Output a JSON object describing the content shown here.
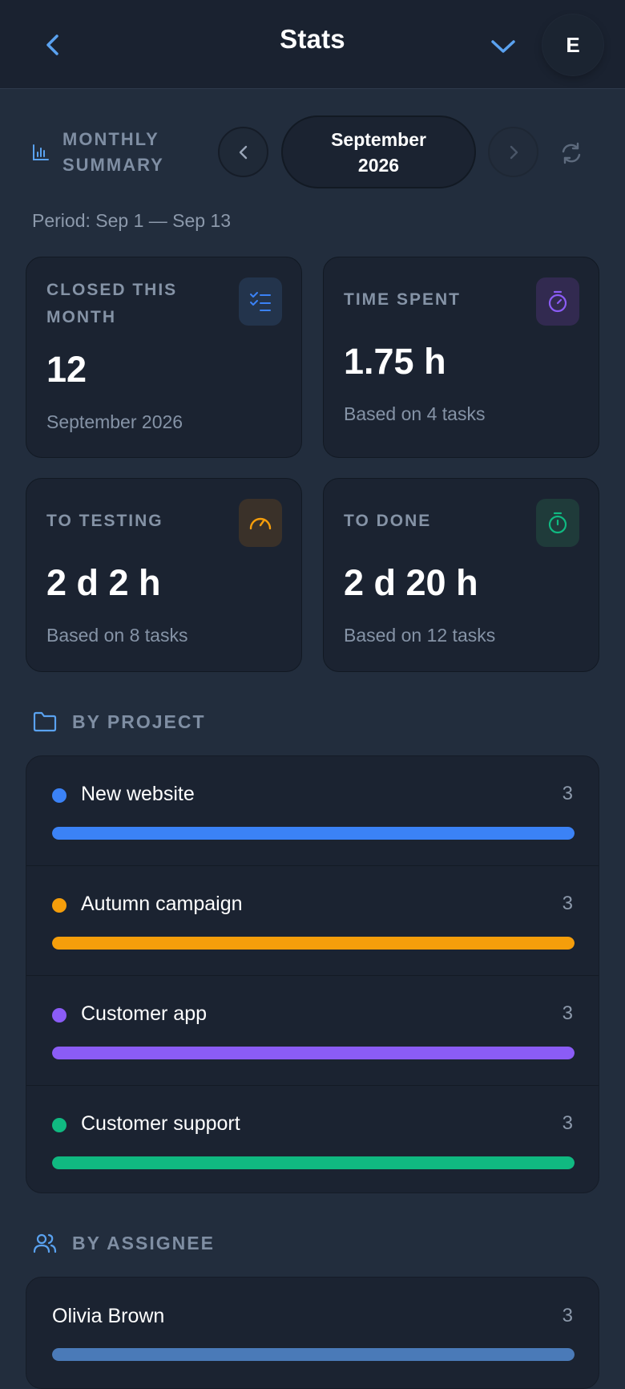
{
  "header": {
    "title": "Stats",
    "avatar_letter": "E",
    "back_icon": "chevron-left-icon",
    "dropdown_icon": "chevron-down-icon"
  },
  "summary": {
    "label": "MONTHLY SUMMARY",
    "month_line1": "September",
    "month_line2": "2026",
    "period": "Period: Sep 1 — Sep 13"
  },
  "cards": {
    "closed": {
      "title": "CLOSED THIS MONTH",
      "value": "12",
      "sub": "September 2026",
      "icon": "checklist-icon",
      "accent": "#3b82f6"
    },
    "time_spent": {
      "title": "TIME SPENT",
      "value": "1.75 h",
      "sub": "Based on 4 tasks",
      "icon": "stopwatch-icon",
      "accent": "#8b5cf6"
    },
    "to_testing": {
      "title": "TO TESTING",
      "value": "2 d 2 h",
      "sub": "Based on 8 tasks",
      "icon": "gauge-icon",
      "accent": "#f59e0b"
    },
    "to_done": {
      "title": "TO DONE",
      "value": "2 d 20 h",
      "sub": "Based on 12 tasks",
      "icon": "timer-icon",
      "accent": "#10b981"
    }
  },
  "by_project": {
    "label": "BY PROJECT",
    "items": [
      {
        "name": "New website",
        "count": "3",
        "color": "#3b82f6",
        "fill": 1.0
      },
      {
        "name": "Autumn campaign",
        "count": "3",
        "color": "#f59e0b",
        "fill": 1.0
      },
      {
        "name": "Customer app",
        "count": "3",
        "color": "#8b5cf6",
        "fill": 1.0
      },
      {
        "name": "Customer support",
        "count": "3",
        "color": "#10b981",
        "fill": 1.0
      }
    ]
  },
  "by_assignee": {
    "label": "BY ASSIGNEE",
    "items": [
      {
        "name": "Olivia Brown",
        "count": "3",
        "color": "#4a7ab8",
        "fill": 1.0
      }
    ]
  }
}
